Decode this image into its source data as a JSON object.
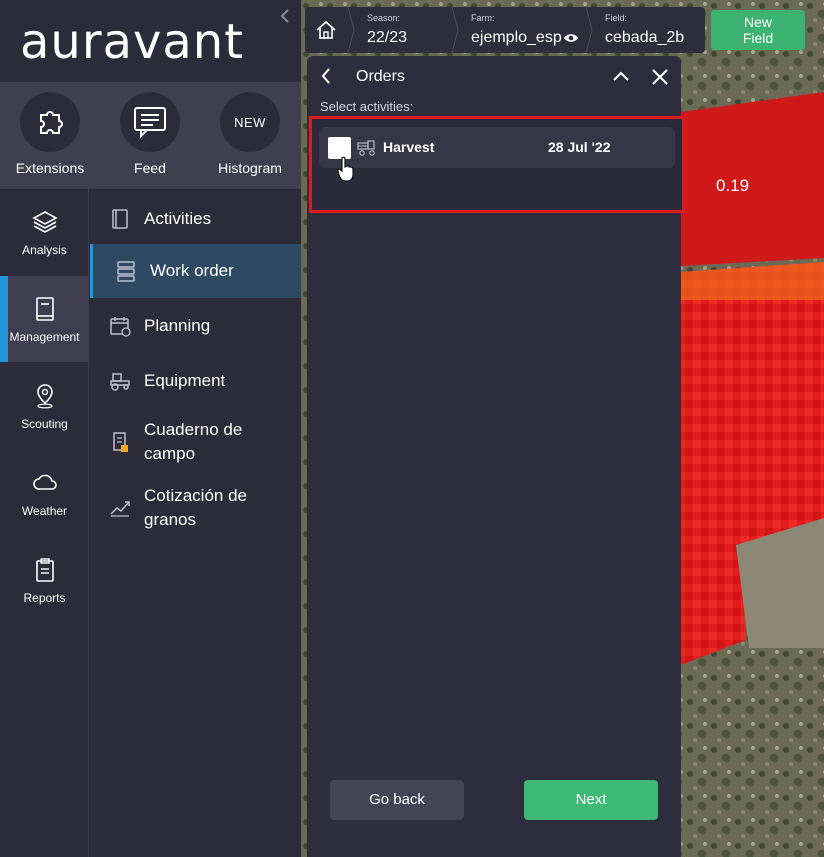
{
  "app": {
    "logo_text": "auravant"
  },
  "quick_actions": [
    {
      "label": "Extensions",
      "icon": "puzzle-icon"
    },
    {
      "label": "Feed",
      "icon": "chat-icon"
    },
    {
      "label": "Histogram",
      "icon": "new-badge",
      "badge": "NEW"
    }
  ],
  "nav": {
    "items": [
      {
        "label": "Analysis",
        "icon": "layers-icon"
      },
      {
        "label": "Management",
        "icon": "notebook-icon"
      },
      {
        "label": "Scouting",
        "icon": "map-pin-icon"
      },
      {
        "label": "Weather",
        "icon": "cloud-icon"
      },
      {
        "label": "Reports",
        "icon": "clipboard-icon"
      }
    ],
    "active": "Management"
  },
  "submenu": {
    "items": [
      {
        "label": "Activities",
        "icon": "book-icon"
      },
      {
        "label": "Work order",
        "icon": "server-icon"
      },
      {
        "label": "Planning",
        "icon": "calendar-icon"
      },
      {
        "label": "Equipment",
        "icon": "tractor-icon"
      },
      {
        "label": "Cuaderno de campo",
        "line1": "Cuaderno de",
        "line2": "campo",
        "icon": "field-notebook-icon"
      },
      {
        "label": "Cotización de granos",
        "line1": "Cotización de",
        "line2": "granos",
        "icon": "chart-trend-icon"
      }
    ],
    "active": "Work order"
  },
  "topbar": {
    "season_label": "Season:",
    "season_value": "22/23",
    "farm_label": "Farm:",
    "farm_value": "ejemplo_esp",
    "field_label": "Field:",
    "field_value": "cebada_2b",
    "new_field_line1": "New",
    "new_field_line2": "Field"
  },
  "map": {
    "value_label": "0.19"
  },
  "orders_panel": {
    "title": "Orders",
    "select_label": "Select activities:",
    "activities": [
      {
        "name": "Harvest",
        "date": "28 Jul '22",
        "checked": false,
        "icon": "harvester-icon"
      }
    ],
    "go_back_label": "Go back",
    "next_label": "Next"
  },
  "colors": {
    "accent_blue": "#2196d8",
    "primary_green": "#3dba75",
    "highlight_red": "#e01b1b",
    "sidebar_bg": "#2b2b3a"
  }
}
